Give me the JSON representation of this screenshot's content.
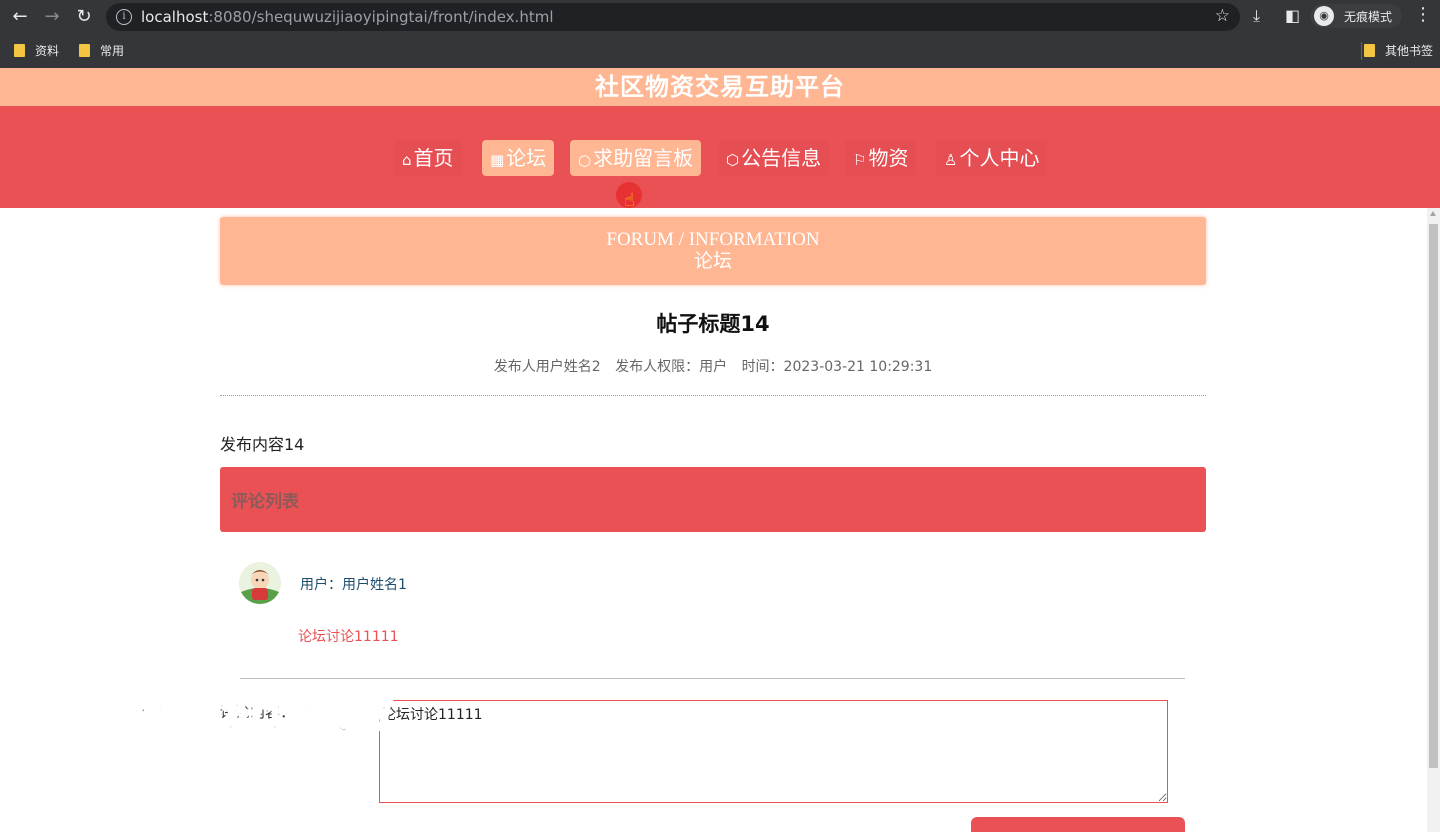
{
  "browser": {
    "url_host": "localhost",
    "url_rest": ":8080/shequwuzijiaoyipingtai/front/index.html",
    "incognito_label": "无痕模式",
    "bookmarks": [
      "资料",
      "常用"
    ],
    "other_bookmarks": "其他书签"
  },
  "site": {
    "title": "社区物资交易互助平台"
  },
  "nav": {
    "items": [
      {
        "icon": "⌂",
        "label": "首页"
      },
      {
        "icon": "▦",
        "label": "论坛"
      },
      {
        "icon": "○",
        "label": "求助留言板"
      },
      {
        "icon": "⬡",
        "label": "公告信息"
      },
      {
        "icon": "⚐",
        "label": "物资"
      },
      {
        "icon": "♙",
        "label": "个人中心"
      }
    ]
  },
  "banner": {
    "en": "FORUM / INFORMATION",
    "cn": "论坛"
  },
  "post": {
    "title": "帖子标题14",
    "author": "发布人用户姓名2",
    "role": "发布人权限：用户",
    "time": "时间：2023-03-21 10:29:31",
    "content": "发布内容14"
  },
  "comments": {
    "header": "评论列表",
    "items": [
      {
        "user": "用户：用户姓名1",
        "text": "论坛讨论11111"
      }
    ]
  },
  "form": {
    "label": "评论内容：",
    "value": "论坛讨论11111"
  },
  "watermark": "专业毕业设计代做"
}
